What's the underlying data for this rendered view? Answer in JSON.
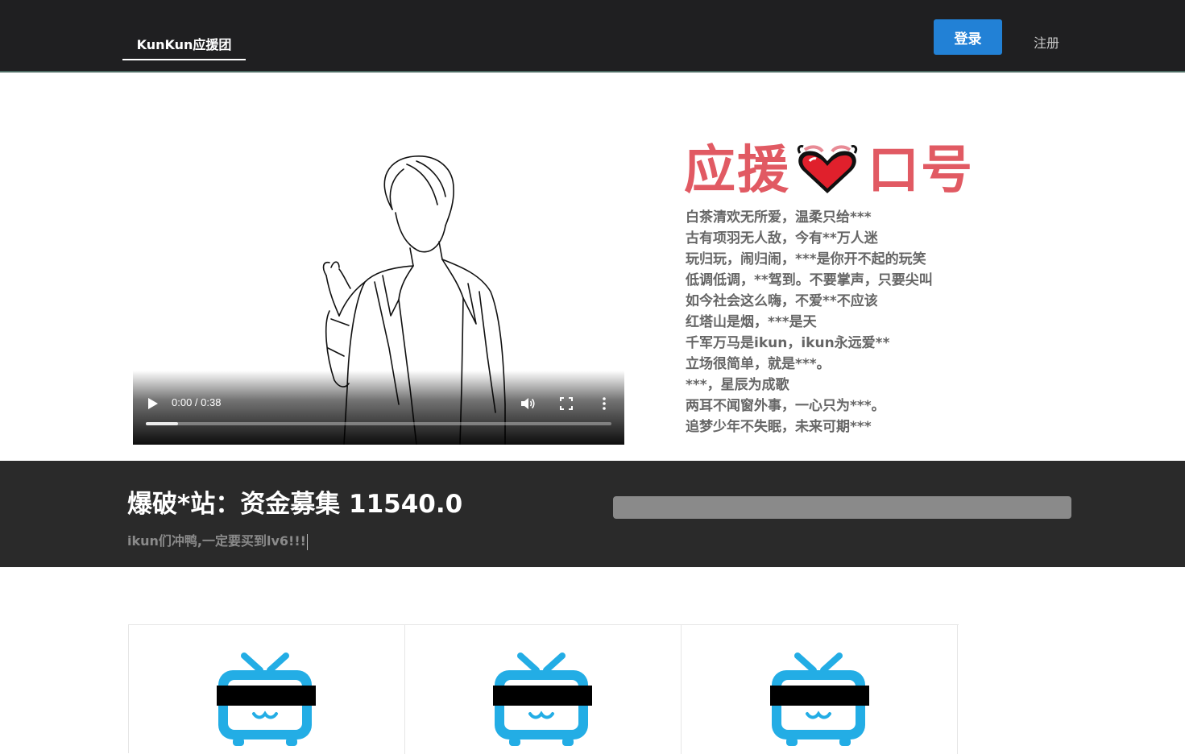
{
  "nav": {
    "brand": "KunKun应援团",
    "login_label": "登录",
    "register_label": "注册"
  },
  "video": {
    "time_display": "0:00 / 0:38",
    "progress_fraction": 0.07
  },
  "slogan": {
    "title_left": "应援",
    "title_right": "口号",
    "lines": [
      "白茶清欢无所爱，温柔只给***",
      "古有项羽无人敌，今有**万人迷",
      "玩归玩，闹归闹，***是你开不起的玩笑",
      "低调低调，**驾到。不要掌声，只要尖叫",
      "如今社会这么嗨，不爱**不应该",
      "红塔山是烟，***是天",
      "千军万马是ikun，ikun永远爱**",
      "立场很简单，就是***。",
      "***，星辰为成歌",
      "两耳不闻窗外事，一心只为***。",
      "追梦少年不失眠，未来可期***"
    ]
  },
  "funding": {
    "title": "爆破*站：资金募集 11540.0",
    "subtitle": "ikun们冲鸭,一定要买到lv6!!!"
  },
  "colors": {
    "nav_bg": "#1f1f21",
    "accent_blue": "#2281d6",
    "slogan_red": "#e15a63",
    "band_bg": "#2a2a2a",
    "tv_blue": "#23ade5"
  }
}
